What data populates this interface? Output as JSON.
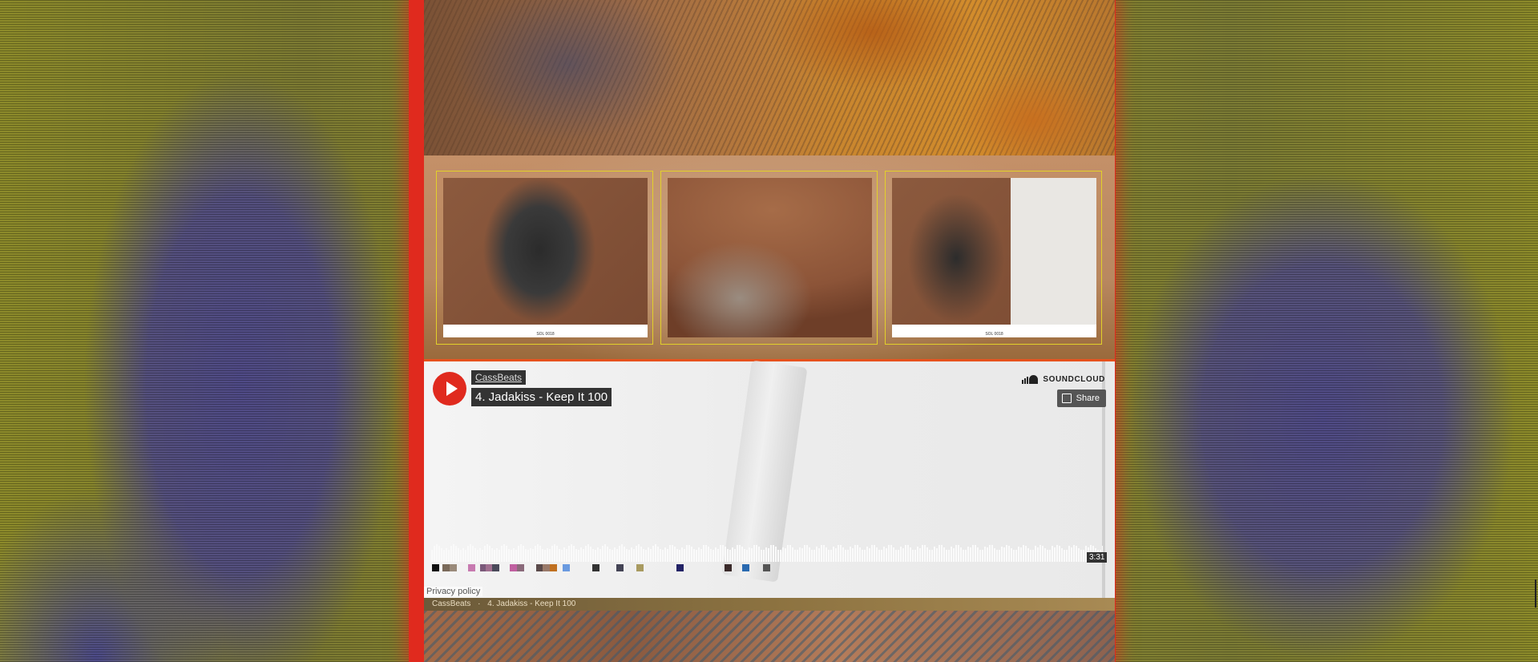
{
  "gallery": {
    "captions": [
      "SOL 0018",
      "",
      "SOL 0018"
    ]
  },
  "player": {
    "uploader": "CassBeats",
    "track_title": "4. Jadakiss - Keep It 100",
    "brand": "SOUNDCLOUD",
    "share_label": "Share",
    "duration": "3:31",
    "privacy_policy": "Privacy policy",
    "accent_color": "#e02a1e"
  },
  "credit": {
    "uploader": "CassBeats",
    "separator": "·",
    "track": "4. Jadakiss - Keep It 100"
  },
  "icons": [
    "play-icon",
    "soundcloud-logo-icon",
    "share-icon"
  ]
}
